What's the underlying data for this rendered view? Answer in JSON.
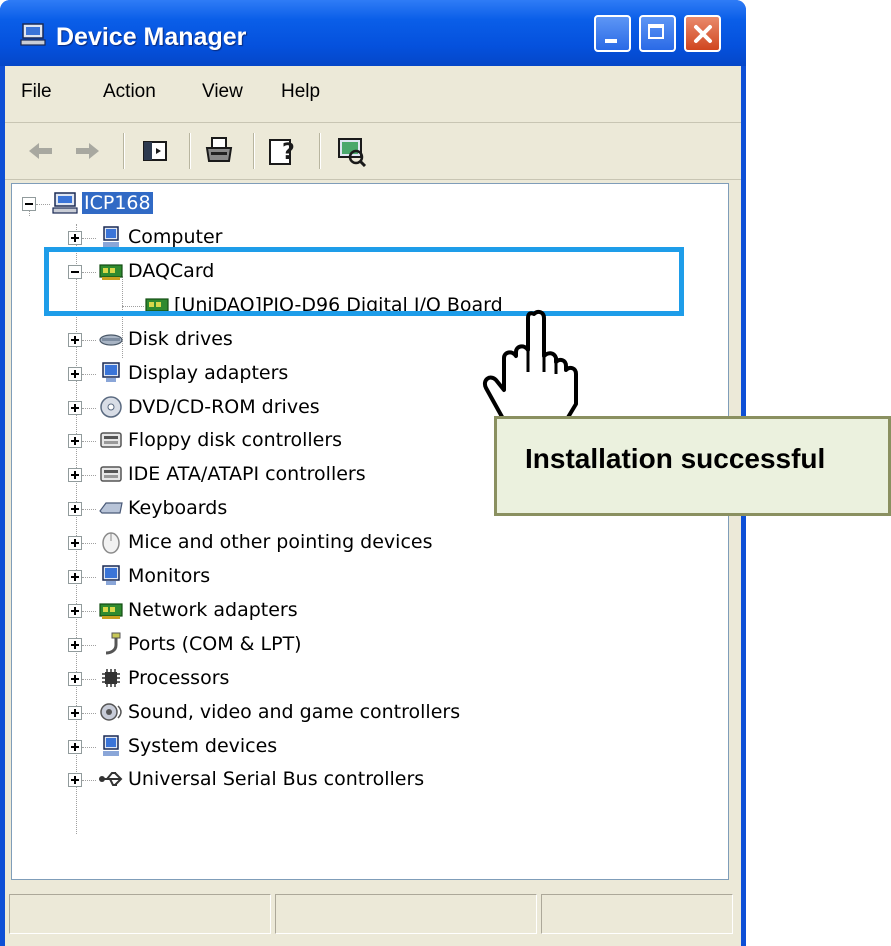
{
  "window": {
    "title": "Device Manager"
  },
  "menubar": {
    "items": [
      "File",
      "Action",
      "View",
      "Help"
    ]
  },
  "toolbar": {
    "buttons": [
      "back-arrow-icon",
      "forward-arrow-icon",
      "show-hide-console-tree-icon",
      "print-icon",
      "help-icon",
      "scan-hardware-icon"
    ]
  },
  "tree": {
    "root": "ICP168",
    "categories": [
      {
        "label": "Computer",
        "icon": "computer-icon",
        "expanded": false
      },
      {
        "label": "DAQCard",
        "icon": "pci-card-icon",
        "expanded": true,
        "children": [
          {
            "label": "[UniDAQ]PIO-D96 Digital I/O Board",
            "icon": "pci-card-icon"
          }
        ]
      },
      {
        "label": "Disk drives",
        "icon": "disk-drive-icon",
        "expanded": false
      },
      {
        "label": "Display adapters",
        "icon": "monitor-icon",
        "expanded": false
      },
      {
        "label": "DVD/CD-ROM drives",
        "icon": "cdrom-icon",
        "expanded": false
      },
      {
        "label": "Floppy disk controllers",
        "icon": "floppy-controller-icon",
        "expanded": false
      },
      {
        "label": "IDE ATA/ATAPI controllers",
        "icon": "ide-controller-icon",
        "expanded": false
      },
      {
        "label": "Keyboards",
        "icon": "keyboard-icon",
        "expanded": false
      },
      {
        "label": "Mice and other pointing devices",
        "icon": "mouse-icon",
        "expanded": false
      },
      {
        "label": "Monitors",
        "icon": "monitor-icon",
        "expanded": false
      },
      {
        "label": "Network adapters",
        "icon": "pci-card-icon",
        "expanded": false
      },
      {
        "label": "Ports (COM & LPT)",
        "icon": "port-icon",
        "expanded": false
      },
      {
        "label": "Processors",
        "icon": "processor-icon",
        "expanded": false
      },
      {
        "label": "Sound, video and game controllers",
        "icon": "speaker-icon",
        "expanded": false
      },
      {
        "label": "System devices",
        "icon": "computer-icon",
        "expanded": false
      },
      {
        "label": "Universal Serial Bus controllers",
        "icon": "usb-icon",
        "expanded": false
      }
    ]
  },
  "annotation": {
    "callout_text": "Installation successful",
    "highlight_color": "#1e9de9",
    "callout_bg": "#ebf1de"
  },
  "colors": {
    "titlebar": "#0551dd",
    "selection": "#316ac5",
    "chrome": "#ece9d8"
  }
}
